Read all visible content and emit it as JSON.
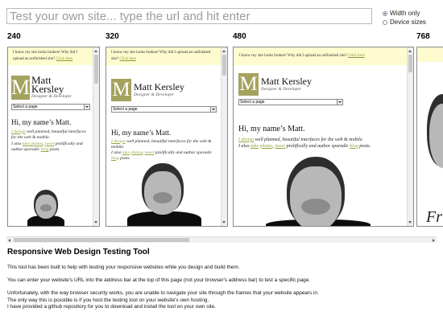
{
  "url_bar": {
    "placeholder": "Test your own site... type the url and hit enter"
  },
  "mode_options": [
    {
      "label": "Width only",
      "selected": true
    },
    {
      "label": "Device sizes",
      "selected": false
    }
  ],
  "frames": [
    {
      "width_label": "240"
    },
    {
      "width_label": "320"
    },
    {
      "width_label": "480"
    },
    {
      "width_label": "768"
    }
  ],
  "site": {
    "banner_text": "I know my site looks broken! Why did I upload an unfinished site?",
    "banner_link": "Click here",
    "logo_letter": "M",
    "logo_name_full": "Matt Kersley",
    "logo_first": "Matt",
    "logo_last": "Kersley",
    "logo_sub": "Designer & Developer",
    "select_label": "Select a page",
    "greeting": "Hi, my name’s Matt.",
    "intro": {
      "link1": "I design",
      "t1": " well planned, beautiful interfaces for the web & mobile.",
      "t2": "I also ",
      "link2": "take photos",
      "t3": ", ",
      "link3": "tweet",
      "t4": " prolifically and author sporadic ",
      "link4": "blog",
      "t5": " posts."
    },
    "partial_text": "Fr"
  },
  "description": {
    "title": "Responsive Web Design Testing Tool",
    "p1": "This tool has been built to help with testing your responsive websites while you design and build them.",
    "p2": "You can enter your website's URL into the address bar at the top of this page (not your browser's address bar) to test a specific page.",
    "p3_lines": [
      "Unfortunately, with the way browser security works, you are unable to navigate your site through the frames that your website appears in.",
      "The only way this is possible is if you host the testing tool on your website's own hosting.",
      "I have provided a github repository for you to download and install the tool on your own site."
    ]
  }
}
